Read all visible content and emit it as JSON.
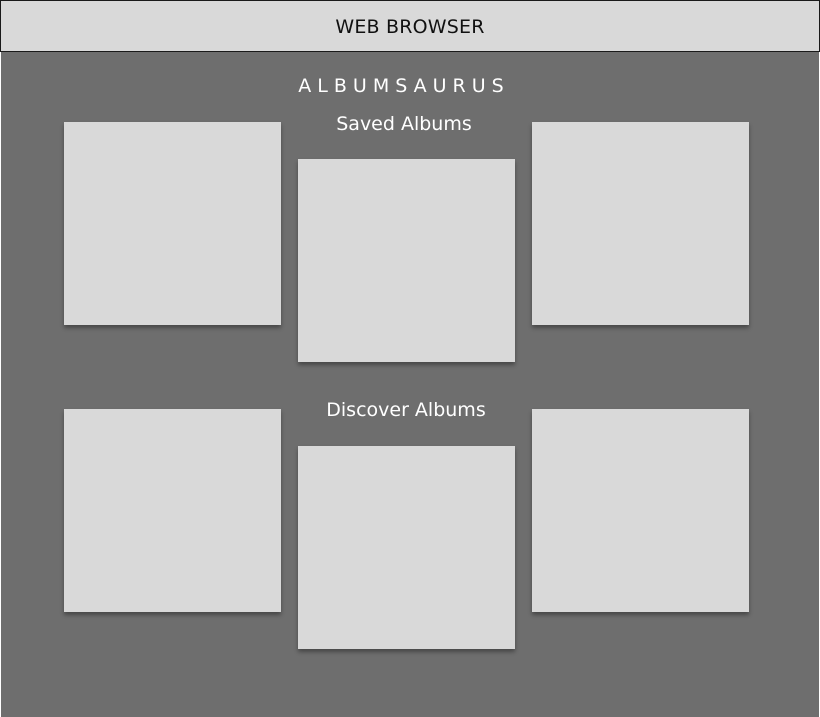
{
  "browser": {
    "label": "WEB BROWSER"
  },
  "app": {
    "title": "ALBUMSAURUS"
  },
  "sections": {
    "saved": {
      "heading": "Saved Albums",
      "album_count": 3
    },
    "discover": {
      "heading": "Discover Albums",
      "album_count": 3
    }
  },
  "colors": {
    "browser_bar": "#d9d9d9",
    "page_background": "#6e6e6e",
    "album_placeholder": "#d9d9d9",
    "text_light": "#ffffff",
    "text_dark": "#111111"
  }
}
